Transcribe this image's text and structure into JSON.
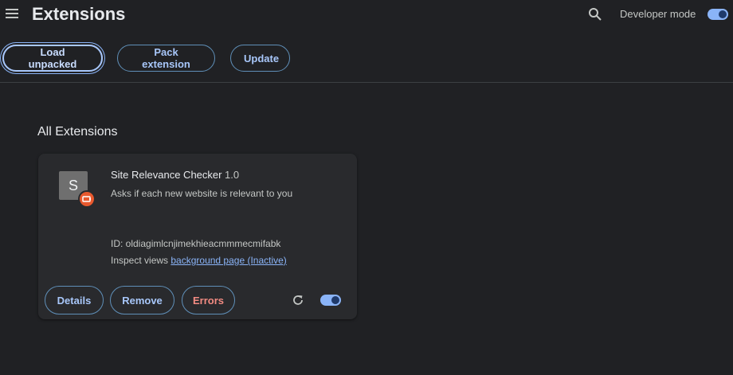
{
  "header": {
    "title": "Extensions",
    "developer_mode_label": "Developer mode",
    "developer_mode_on": true
  },
  "toolbar": {
    "load_unpacked": "Load unpacked",
    "pack_extension": "Pack extension",
    "update": "Update"
  },
  "section": {
    "title": "All Extensions"
  },
  "extension": {
    "icon_letter": "S",
    "name": "Site Relevance Checker",
    "version": "1.0",
    "description": "Asks if each new website is relevant to you",
    "id_text": "ID: oldiagimlcnjimekhieacmmmecmifabk",
    "inspect_label": "Inspect views",
    "inspect_link": "background page (Inactive)",
    "enabled": true,
    "buttons": {
      "details": "Details",
      "remove": "Remove",
      "errors": "Errors"
    }
  },
  "icons": {
    "menu": "hamburger-menu-icon",
    "search": "search-icon",
    "badge": "unpacked-extension-badge-icon",
    "reload": "reload-icon"
  },
  "colors": {
    "background": "#202124",
    "card": "#292a2d",
    "accent": "#8ab4f8",
    "error": "#f28b82",
    "badge": "#e8592e"
  }
}
